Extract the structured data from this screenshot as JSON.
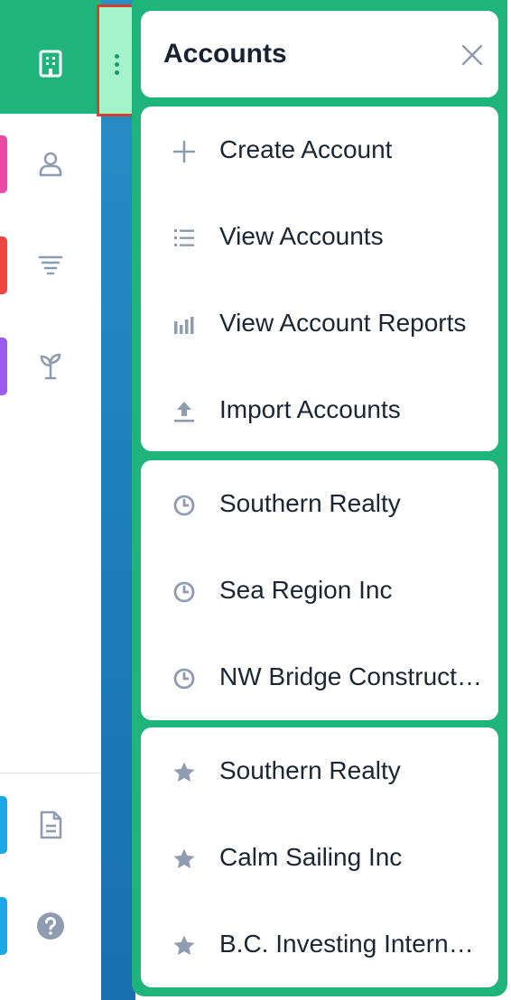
{
  "panel": {
    "title": "Accounts",
    "close_icon": "close-icon"
  },
  "actions": [
    {
      "label": "Create Account",
      "icon": "plus-icon"
    },
    {
      "label": "View Accounts",
      "icon": "list-icon"
    },
    {
      "label": "View Account Reports",
      "icon": "bar-chart-icon"
    },
    {
      "label": "Import Accounts",
      "icon": "upload-icon"
    }
  ],
  "recent": [
    {
      "label": "Southern Realty",
      "icon": "clock-icon"
    },
    {
      "label": "Sea Region Inc",
      "icon": "clock-icon"
    },
    {
      "label": "NW Bridge Construction",
      "icon": "clock-icon"
    }
  ],
  "favorites": [
    {
      "label": "Southern Realty",
      "icon": "star-icon"
    },
    {
      "label": "Calm Sailing Inc",
      "icon": "star-icon"
    },
    {
      "label": "B.C. Investing International",
      "icon": "star-icon"
    }
  ],
  "sidebar": {
    "items": [
      {
        "icon": "building-icon",
        "active": true
      },
      {
        "icon": "person-icon",
        "accent": "#ea4aa3"
      },
      {
        "icon": "filter-icon",
        "accent": "#ef4545"
      },
      {
        "icon": "sprout-icon",
        "accent": "#9b5cf0"
      },
      {
        "icon": "document-icon",
        "accent": "#1ea7e6"
      },
      {
        "icon": "help-icon",
        "accent": "#1ea7e6"
      }
    ]
  },
  "colors": {
    "brand_green": "#1fb47c",
    "strip_blue": "#1d7fbc",
    "highlight_red": "#d6412b",
    "text_dark": "#1c2533",
    "icon_gray": "#8f9bb0"
  }
}
